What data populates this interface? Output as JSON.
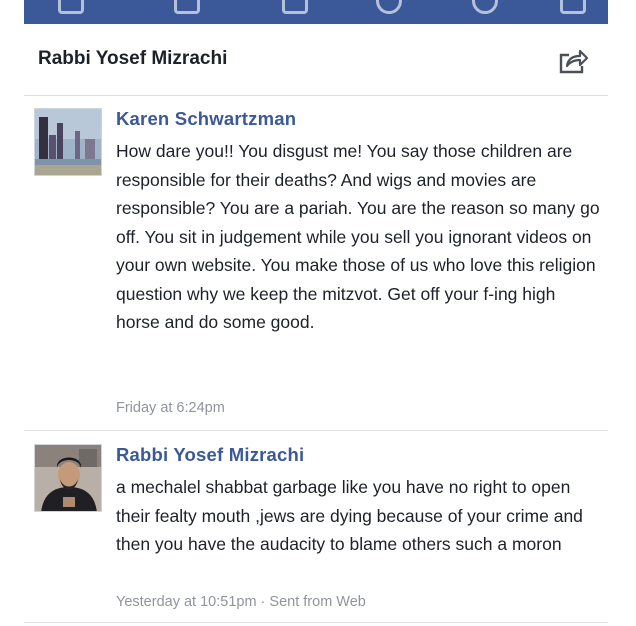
{
  "header": {
    "title": "Rabbi Yosef Mizrachi"
  },
  "icons": {
    "share": "share-icon"
  },
  "comments": [
    {
      "author": "Karen Schwartzman",
      "text": "How dare you!! You disgust me! You say those children are responsible for their deaths? And wigs and movies are responsible? You are a pariah. You are the reason so many go off. You sit in judgement while you sell you ignorant videos on your own website. You make those of us who love this religion question why we keep the mitzvot. Get off your f-ing high horse and do some good.",
      "timestamp": "Friday at 6:24pm"
    },
    {
      "author": "Rabbi Yosef Mizrachi",
      "text": "a mechalel shabbat garbage like you have no right to open their fealty mouth ,jews are dying because of your crime and then you have the audacity to blame others such a moron",
      "timestamp": "Yesterday at 10:51pm · Sent from Web"
    }
  ],
  "colors": {
    "navbar": "#3b5998",
    "author_link": "#3b5998",
    "meta": "#90949c"
  }
}
